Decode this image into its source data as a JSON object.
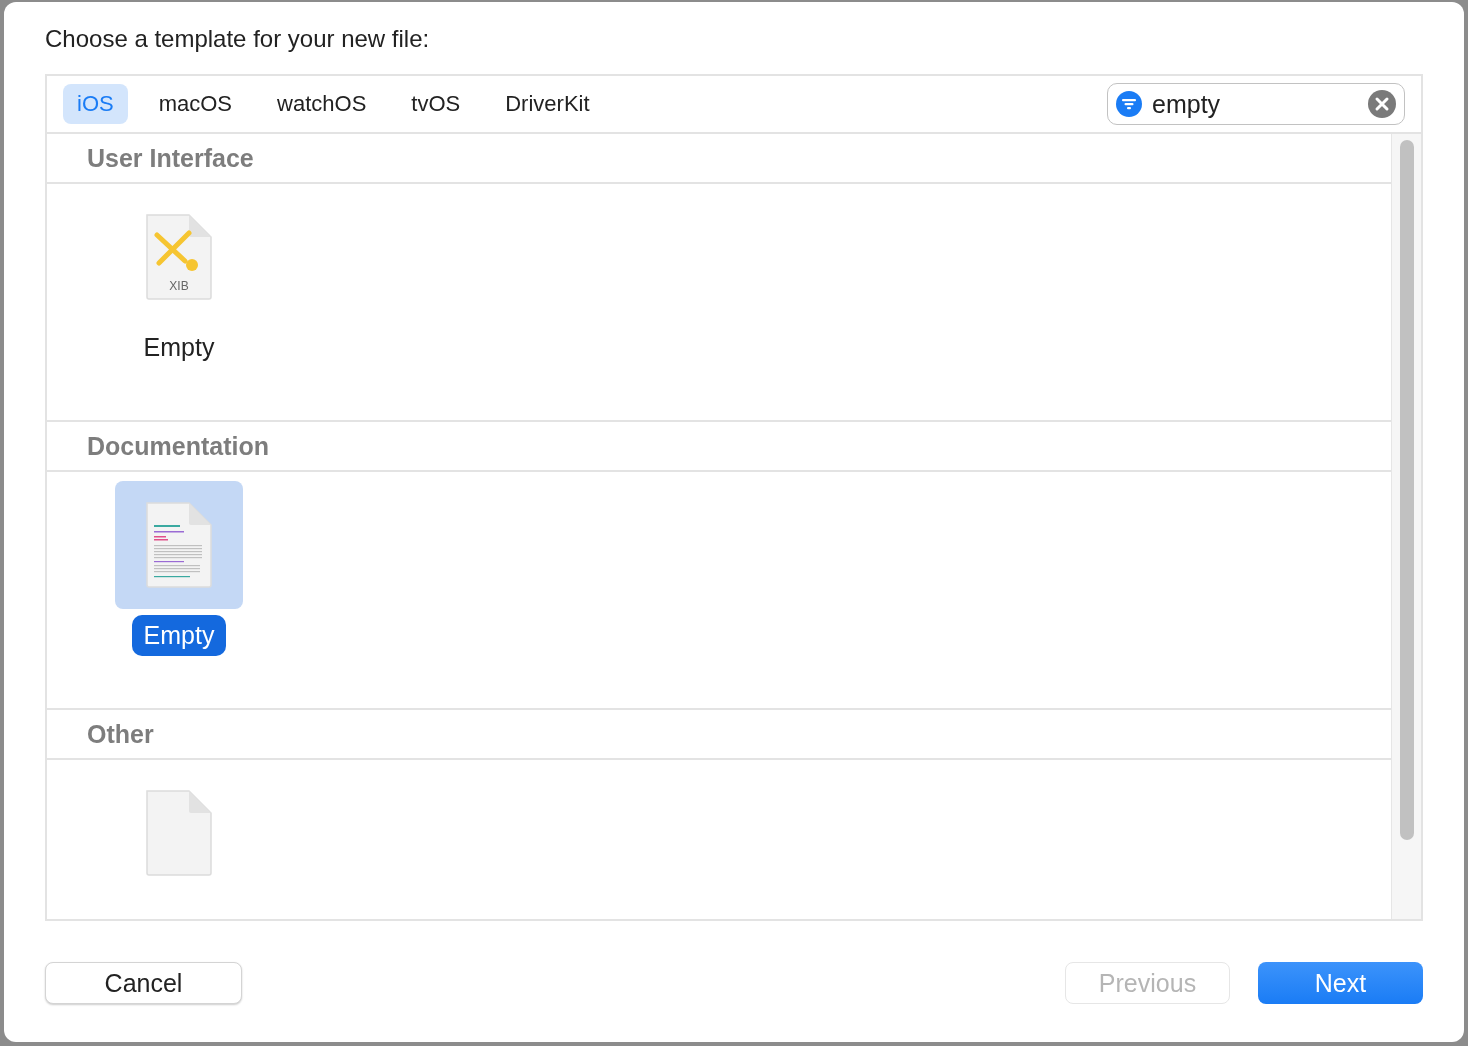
{
  "dialog": {
    "title": "Choose a template for your new file:"
  },
  "tabs": [
    {
      "label": "iOS",
      "selected": true
    },
    {
      "label": "macOS",
      "selected": false
    },
    {
      "label": "watchOS",
      "selected": false
    },
    {
      "label": "tvOS",
      "selected": false
    },
    {
      "label": "DriverKit",
      "selected": false
    }
  ],
  "search": {
    "value": "empty"
  },
  "sections": [
    {
      "title": "User Interface",
      "items": [
        {
          "kind": "xib",
          "badge": "XIB",
          "label": "Empty",
          "selected": false
        }
      ]
    },
    {
      "title": "Documentation",
      "items": [
        {
          "kind": "document",
          "label": "Empty",
          "selected": true
        }
      ]
    },
    {
      "title": "Other",
      "items": [
        {
          "kind": "blank",
          "selected": false
        }
      ]
    }
  ],
  "buttons": [
    {
      "label": "Cancel",
      "kind": "normal",
      "disabled": false
    },
    {
      "label": "Previous",
      "kind": "normal",
      "disabled": true
    },
    {
      "label": "Next",
      "kind": "default",
      "disabled": false
    }
  ]
}
